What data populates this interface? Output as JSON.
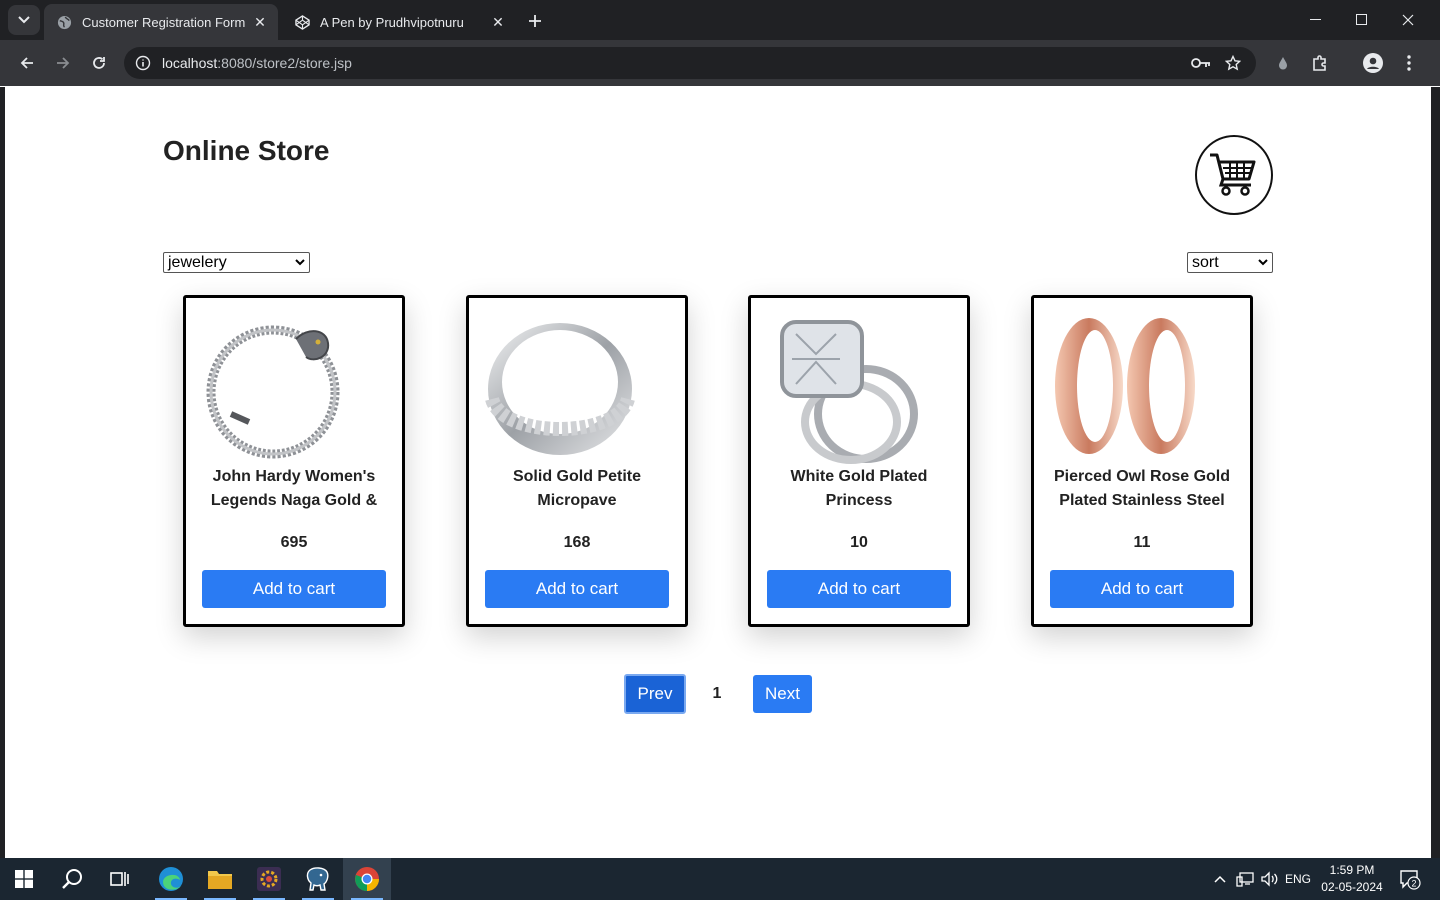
{
  "browser": {
    "tabs": [
      {
        "title": "Customer Registration Form",
        "active": true
      },
      {
        "title": "A Pen by Prudhvipotnuru",
        "active": false
      }
    ],
    "url_host": "localhost",
    "url_path": ":8080/store2/store.jsp"
  },
  "page": {
    "title": "Online Store",
    "category_select": "jewelery",
    "sort_select": "sort",
    "products": [
      {
        "name": "John Hardy Women's Legends Naga Gold & Silver Dragon Station Chain Bracelet",
        "price": "695",
        "button": "Add to cart"
      },
      {
        "name": "Solid Gold Petite Micropave",
        "price": "168",
        "button": "Add to cart"
      },
      {
        "name": "White Gold Plated Princess",
        "price": "10",
        "button": "Add to cart"
      },
      {
        "name": "Pierced Owl Rose Gold Plated Stainless Steel Double",
        "price": "11",
        "button": "Add to cart"
      }
    ],
    "pagination": {
      "prev": "Prev",
      "page": "1",
      "next": "Next"
    }
  },
  "taskbar": {
    "language": "ENG",
    "time": "1:59 PM",
    "date": "02-05-2024",
    "notifications": "2"
  },
  "colors": {
    "primary_button": "#2a7bf3",
    "chrome_dark": "#202124",
    "chrome_toolbar": "#35363a",
    "taskbar": "#1b2631"
  }
}
